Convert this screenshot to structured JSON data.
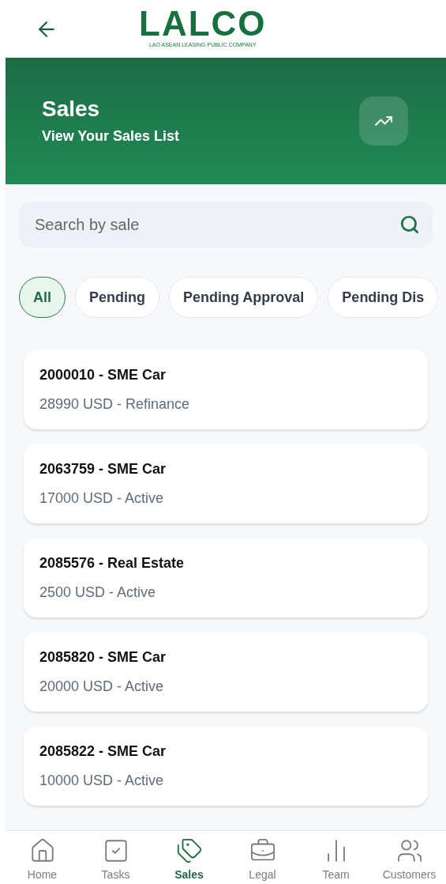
{
  "logo": {
    "name": "LALCO",
    "tagline": "LAO ASEAN LEASING PUBLIC COMPANY"
  },
  "banner": {
    "title": "Sales",
    "subtitle": "View Your Sales List"
  },
  "search": {
    "placeholder": "Search by sale"
  },
  "filters": [
    {
      "label": "All",
      "selected": true
    },
    {
      "label": "Pending",
      "selected": false
    },
    {
      "label": "Pending Approval",
      "selected": false
    },
    {
      "label": "Pending Dis",
      "selected": false
    }
  ],
  "sales": [
    {
      "title": "2000010 - SME Car",
      "detail": "28990 USD - Refinance"
    },
    {
      "title": "2063759 - SME Car",
      "detail": "17000 USD - Active"
    },
    {
      "title": "2085576 - Real Estate",
      "detail": "2500 USD - Active"
    },
    {
      "title": "2085820 - SME Car",
      "detail": "20000 USD - Active"
    },
    {
      "title": "2085822 - SME Car",
      "detail": "10000 USD - Active"
    }
  ],
  "nav": [
    {
      "kind": "home",
      "label": "Home",
      "selected": false
    },
    {
      "kind": "tasks",
      "label": "Tasks",
      "selected": false
    },
    {
      "kind": "sales",
      "label": "Sales",
      "selected": true
    },
    {
      "kind": "legal",
      "label": "Legal",
      "selected": false
    },
    {
      "kind": "team",
      "label": "Team",
      "selected": false
    },
    {
      "kind": "customers",
      "label": "Customers",
      "selected": false
    }
  ]
}
